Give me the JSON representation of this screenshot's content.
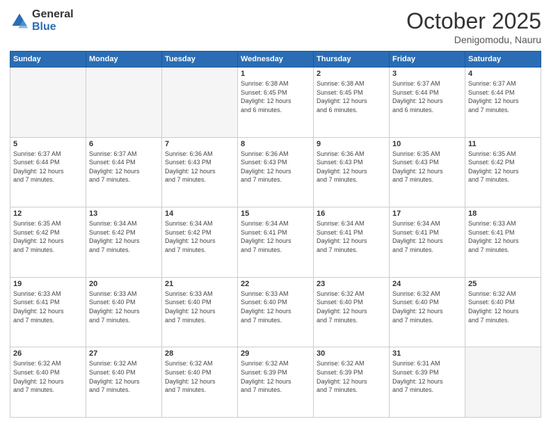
{
  "logo": {
    "general": "General",
    "blue": "Blue"
  },
  "header": {
    "month": "October 2025",
    "location": "Denigomodu, Nauru"
  },
  "weekdays": [
    "Sunday",
    "Monday",
    "Tuesday",
    "Wednesday",
    "Thursday",
    "Friday",
    "Saturday"
  ],
  "weeks": [
    [
      {
        "day": "",
        "info": ""
      },
      {
        "day": "",
        "info": ""
      },
      {
        "day": "",
        "info": ""
      },
      {
        "day": "1",
        "info": "Sunrise: 6:38 AM\nSunset: 6:45 PM\nDaylight: 12 hours\nand 6 minutes."
      },
      {
        "day": "2",
        "info": "Sunrise: 6:38 AM\nSunset: 6:45 PM\nDaylight: 12 hours\nand 6 minutes."
      },
      {
        "day": "3",
        "info": "Sunrise: 6:37 AM\nSunset: 6:44 PM\nDaylight: 12 hours\nand 6 minutes."
      },
      {
        "day": "4",
        "info": "Sunrise: 6:37 AM\nSunset: 6:44 PM\nDaylight: 12 hours\nand 7 minutes."
      }
    ],
    [
      {
        "day": "5",
        "info": "Sunrise: 6:37 AM\nSunset: 6:44 PM\nDaylight: 12 hours\nand 7 minutes."
      },
      {
        "day": "6",
        "info": "Sunrise: 6:37 AM\nSunset: 6:44 PM\nDaylight: 12 hours\nand 7 minutes."
      },
      {
        "day": "7",
        "info": "Sunrise: 6:36 AM\nSunset: 6:43 PM\nDaylight: 12 hours\nand 7 minutes."
      },
      {
        "day": "8",
        "info": "Sunrise: 6:36 AM\nSunset: 6:43 PM\nDaylight: 12 hours\nand 7 minutes."
      },
      {
        "day": "9",
        "info": "Sunrise: 6:36 AM\nSunset: 6:43 PM\nDaylight: 12 hours\nand 7 minutes."
      },
      {
        "day": "10",
        "info": "Sunrise: 6:35 AM\nSunset: 6:43 PM\nDaylight: 12 hours\nand 7 minutes."
      },
      {
        "day": "11",
        "info": "Sunrise: 6:35 AM\nSunset: 6:42 PM\nDaylight: 12 hours\nand 7 minutes."
      }
    ],
    [
      {
        "day": "12",
        "info": "Sunrise: 6:35 AM\nSunset: 6:42 PM\nDaylight: 12 hours\nand 7 minutes."
      },
      {
        "day": "13",
        "info": "Sunrise: 6:34 AM\nSunset: 6:42 PM\nDaylight: 12 hours\nand 7 minutes."
      },
      {
        "day": "14",
        "info": "Sunrise: 6:34 AM\nSunset: 6:42 PM\nDaylight: 12 hours\nand 7 minutes."
      },
      {
        "day": "15",
        "info": "Sunrise: 6:34 AM\nSunset: 6:41 PM\nDaylight: 12 hours\nand 7 minutes."
      },
      {
        "day": "16",
        "info": "Sunrise: 6:34 AM\nSunset: 6:41 PM\nDaylight: 12 hours\nand 7 minutes."
      },
      {
        "day": "17",
        "info": "Sunrise: 6:34 AM\nSunset: 6:41 PM\nDaylight: 12 hours\nand 7 minutes."
      },
      {
        "day": "18",
        "info": "Sunrise: 6:33 AM\nSunset: 6:41 PM\nDaylight: 12 hours\nand 7 minutes."
      }
    ],
    [
      {
        "day": "19",
        "info": "Sunrise: 6:33 AM\nSunset: 6:41 PM\nDaylight: 12 hours\nand 7 minutes."
      },
      {
        "day": "20",
        "info": "Sunrise: 6:33 AM\nSunset: 6:40 PM\nDaylight: 12 hours\nand 7 minutes."
      },
      {
        "day": "21",
        "info": "Sunrise: 6:33 AM\nSunset: 6:40 PM\nDaylight: 12 hours\nand 7 minutes."
      },
      {
        "day": "22",
        "info": "Sunrise: 6:33 AM\nSunset: 6:40 PM\nDaylight: 12 hours\nand 7 minutes."
      },
      {
        "day": "23",
        "info": "Sunrise: 6:32 AM\nSunset: 6:40 PM\nDaylight: 12 hours\nand 7 minutes."
      },
      {
        "day": "24",
        "info": "Sunrise: 6:32 AM\nSunset: 6:40 PM\nDaylight: 12 hours\nand 7 minutes."
      },
      {
        "day": "25",
        "info": "Sunrise: 6:32 AM\nSunset: 6:40 PM\nDaylight: 12 hours\nand 7 minutes."
      }
    ],
    [
      {
        "day": "26",
        "info": "Sunrise: 6:32 AM\nSunset: 6:40 PM\nDaylight: 12 hours\nand 7 minutes."
      },
      {
        "day": "27",
        "info": "Sunrise: 6:32 AM\nSunset: 6:40 PM\nDaylight: 12 hours\nand 7 minutes."
      },
      {
        "day": "28",
        "info": "Sunrise: 6:32 AM\nSunset: 6:40 PM\nDaylight: 12 hours\nand 7 minutes."
      },
      {
        "day": "29",
        "info": "Sunrise: 6:32 AM\nSunset: 6:39 PM\nDaylight: 12 hours\nand 7 minutes."
      },
      {
        "day": "30",
        "info": "Sunrise: 6:32 AM\nSunset: 6:39 PM\nDaylight: 12 hours\nand 7 minutes."
      },
      {
        "day": "31",
        "info": "Sunrise: 6:31 AM\nSunset: 6:39 PM\nDaylight: 12 hours\nand 7 minutes."
      },
      {
        "day": "",
        "info": ""
      }
    ]
  ]
}
